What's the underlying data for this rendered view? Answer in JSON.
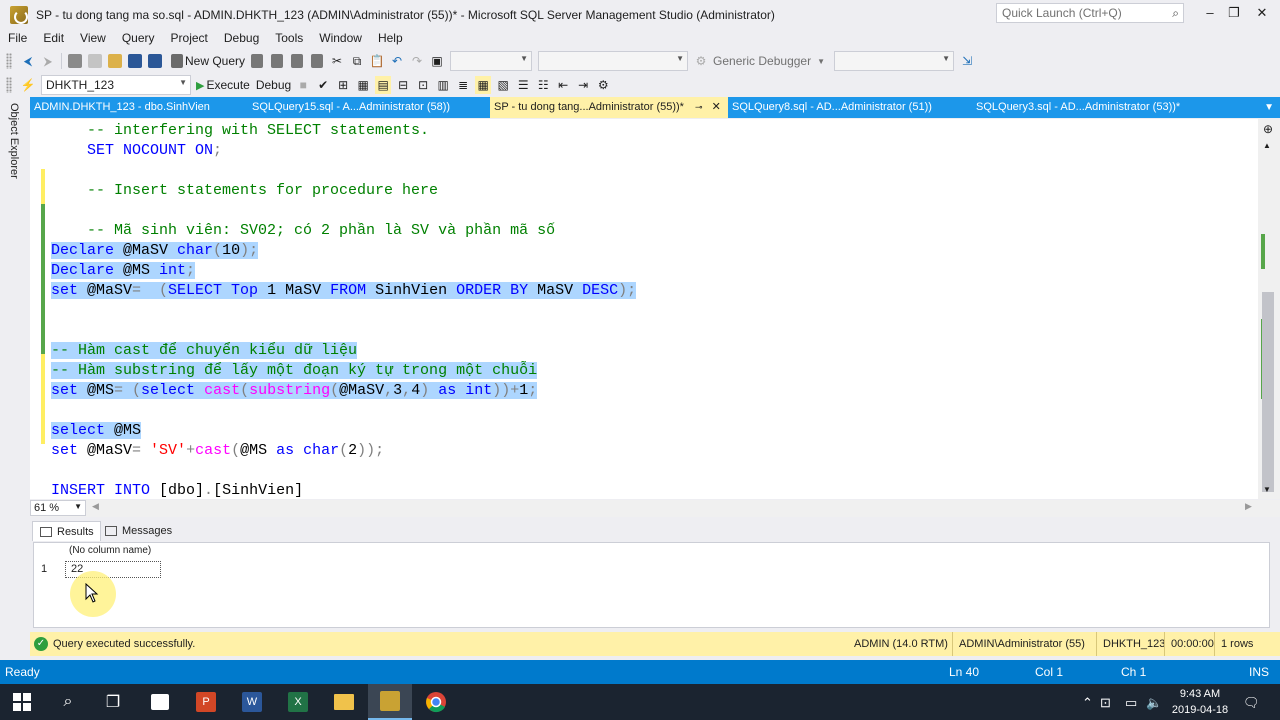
{
  "window": {
    "title": "SP - tu dong tang ma so.sql - ADMIN.DHKTH_123 (ADMIN\\Administrator (55))* - Microsoft SQL Server Management Studio (Administrator)",
    "quick_launch_placeholder": "Quick Launch (Ctrl+Q)"
  },
  "menu": [
    "File",
    "Edit",
    "View",
    "Query",
    "Project",
    "Debug",
    "Tools",
    "Window",
    "Help"
  ],
  "toolbar1": {
    "new_query": "New Query",
    "debugger": "Generic Debugger"
  },
  "toolbar2": {
    "database": "DHKTH_123",
    "execute": "Execute",
    "debug": "Debug"
  },
  "object_explorer": "Object Explorer",
  "tabs": [
    {
      "label": "ADMIN.DHKTH_123 - dbo.SinhVien",
      "active": false
    },
    {
      "label": "SQLQuery15.sql - A...Administrator (58))",
      "active": false
    },
    {
      "label": "SP - tu dong tang...Administrator (55))*",
      "active": true
    },
    {
      "label": "SQLQuery8.sql - AD...Administrator (51))",
      "active": false
    },
    {
      "label": "SQLQuery3.sql - AD...Administrator (53))*",
      "active": false
    }
  ],
  "code_lines": [
    {
      "parts": [
        {
          "t": "    -- interfering with SELECT statements.",
          "c": "cm"
        }
      ],
      "sel": false
    },
    {
      "parts": [
        {
          "t": "    ",
          "c": "tx"
        },
        {
          "t": "SET NOCOUNT ON",
          "c": "kw"
        },
        {
          "t": ";",
          "c": "gy"
        }
      ],
      "sel": false
    },
    {
      "parts": [
        {
          "t": "",
          "c": "tx"
        }
      ],
      "sel": false
    },
    {
      "parts": [
        {
          "t": "    -- Insert statements for procedure here",
          "c": "cm"
        }
      ],
      "sel": false
    },
    {
      "parts": [
        {
          "t": "",
          "c": "tx"
        }
      ],
      "sel": false
    },
    {
      "parts": [
        {
          "t": "    -- Mã sinh viên: SV02; có 2 phần là SV và phần mã số",
          "c": "cm"
        }
      ],
      "sel": false
    },
    {
      "parts": [
        {
          "t": "Declare ",
          "c": "kw"
        },
        {
          "t": "@MaSV ",
          "c": "tx"
        },
        {
          "t": "char",
          "c": "ty"
        },
        {
          "t": "(",
          "c": "gy"
        },
        {
          "t": "10",
          "c": "tx"
        },
        {
          "t": ");",
          "c": "gy"
        }
      ],
      "sel": true
    },
    {
      "parts": [
        {
          "t": "Declare ",
          "c": "kw"
        },
        {
          "t": "@MS ",
          "c": "tx"
        },
        {
          "t": "int",
          "c": "ty"
        },
        {
          "t": ";",
          "c": "gy"
        }
      ],
      "sel": true
    },
    {
      "parts": [
        {
          "t": "set ",
          "c": "kw"
        },
        {
          "t": "@MaSV",
          "c": "tx"
        },
        {
          "t": "=  (",
          "c": "gy"
        },
        {
          "t": "SELECT Top ",
          "c": "kw"
        },
        {
          "t": "1 MaSV ",
          "c": "tx"
        },
        {
          "t": "FROM ",
          "c": "kw"
        },
        {
          "t": "SinhVien ",
          "c": "tx"
        },
        {
          "t": "ORDER BY ",
          "c": "kw"
        },
        {
          "t": "MaSV ",
          "c": "tx"
        },
        {
          "t": "DESC",
          "c": "kw"
        },
        {
          "t": ");",
          "c": "gy"
        }
      ],
      "sel": true
    },
    {
      "parts": [
        {
          "t": "",
          "c": "tx"
        }
      ],
      "sel": false
    },
    {
      "parts": [
        {
          "t": "",
          "c": "tx"
        }
      ],
      "sel": false
    },
    {
      "parts": [
        {
          "t": "-- Hàm cast để chuyển kiểu dữ liệu",
          "c": "cm"
        }
      ],
      "sel": true
    },
    {
      "parts": [
        {
          "t": "-- Hàm substring để lấy một đoạn ký tự trong một chuỗi",
          "c": "cm"
        }
      ],
      "sel": true
    },
    {
      "parts": [
        {
          "t": "set ",
          "c": "kw"
        },
        {
          "t": "@MS",
          "c": "tx"
        },
        {
          "t": "= (",
          "c": "gy"
        },
        {
          "t": "select ",
          "c": "kw"
        },
        {
          "t": "cast",
          "c": "fn"
        },
        {
          "t": "(",
          "c": "gy"
        },
        {
          "t": "substring",
          "c": "fn"
        },
        {
          "t": "(",
          "c": "gy"
        },
        {
          "t": "@MaSV",
          "c": "tx"
        },
        {
          "t": ",",
          "c": "gy"
        },
        {
          "t": "3",
          "c": "tx"
        },
        {
          "t": ",",
          "c": "gy"
        },
        {
          "t": "4",
          "c": "tx"
        },
        {
          "t": ") ",
          "c": "gy"
        },
        {
          "t": "as int",
          "c": "kw"
        },
        {
          "t": "))+",
          "c": "gy"
        },
        {
          "t": "1",
          "c": "tx"
        },
        {
          "t": ";",
          "c": "gy"
        }
      ],
      "sel": true
    },
    {
      "parts": [
        {
          "t": "",
          "c": "tx"
        }
      ],
      "sel": false
    },
    {
      "parts": [
        {
          "t": "select ",
          "c": "kw"
        },
        {
          "t": "@MS",
          "c": "tx"
        }
      ],
      "sel": true
    },
    {
      "parts": [
        {
          "t": "set ",
          "c": "kw"
        },
        {
          "t": "@MaSV",
          "c": "tx"
        },
        {
          "t": "= ",
          "c": "gy"
        },
        {
          "t": "'SV'",
          "c": "st"
        },
        {
          "t": "+",
          "c": "gy"
        },
        {
          "t": "cast",
          "c": "fn"
        },
        {
          "t": "(",
          "c": "gy"
        },
        {
          "t": "@MS ",
          "c": "tx"
        },
        {
          "t": "as char",
          "c": "kw"
        },
        {
          "t": "(",
          "c": "gy"
        },
        {
          "t": "2",
          "c": "tx"
        },
        {
          "t": "));",
          "c": "gy"
        }
      ],
      "sel": false
    },
    {
      "parts": [
        {
          "t": "",
          "c": "tx"
        }
      ],
      "sel": false
    },
    {
      "parts": [
        {
          "t": "INSERT INTO ",
          "c": "kw"
        },
        {
          "t": "[dbo]",
          "c": "tx"
        },
        {
          "t": ".",
          "c": "gy"
        },
        {
          "t": "[SinhVien]",
          "c": "tx"
        }
      ],
      "sel": false
    }
  ],
  "zoom": "61 %",
  "results": {
    "tab_results": "Results",
    "tab_messages": "Messages",
    "column_header": "(No column name)",
    "row_number": "1",
    "cell_value": "22"
  },
  "query_status": {
    "message": "Query executed successfully.",
    "server": "ADMIN (14.0 RTM)",
    "user": "ADMIN\\Administrator (55)",
    "database": "DHKTH_123",
    "elapsed": "00:00:00",
    "rows": "1 rows"
  },
  "statusbar": {
    "ready": "Ready",
    "ln": "Ln 40",
    "col": "Col 1",
    "ch": "Ch 1",
    "mode": "INS"
  },
  "clock": {
    "time": "9:43 AM",
    "date": "2019-04-18"
  },
  "colors": {
    "accent": "#007acc",
    "tab_bar": "#1c97ea",
    "active_tab": "#fff1a8",
    "selection": "#add6ff"
  }
}
